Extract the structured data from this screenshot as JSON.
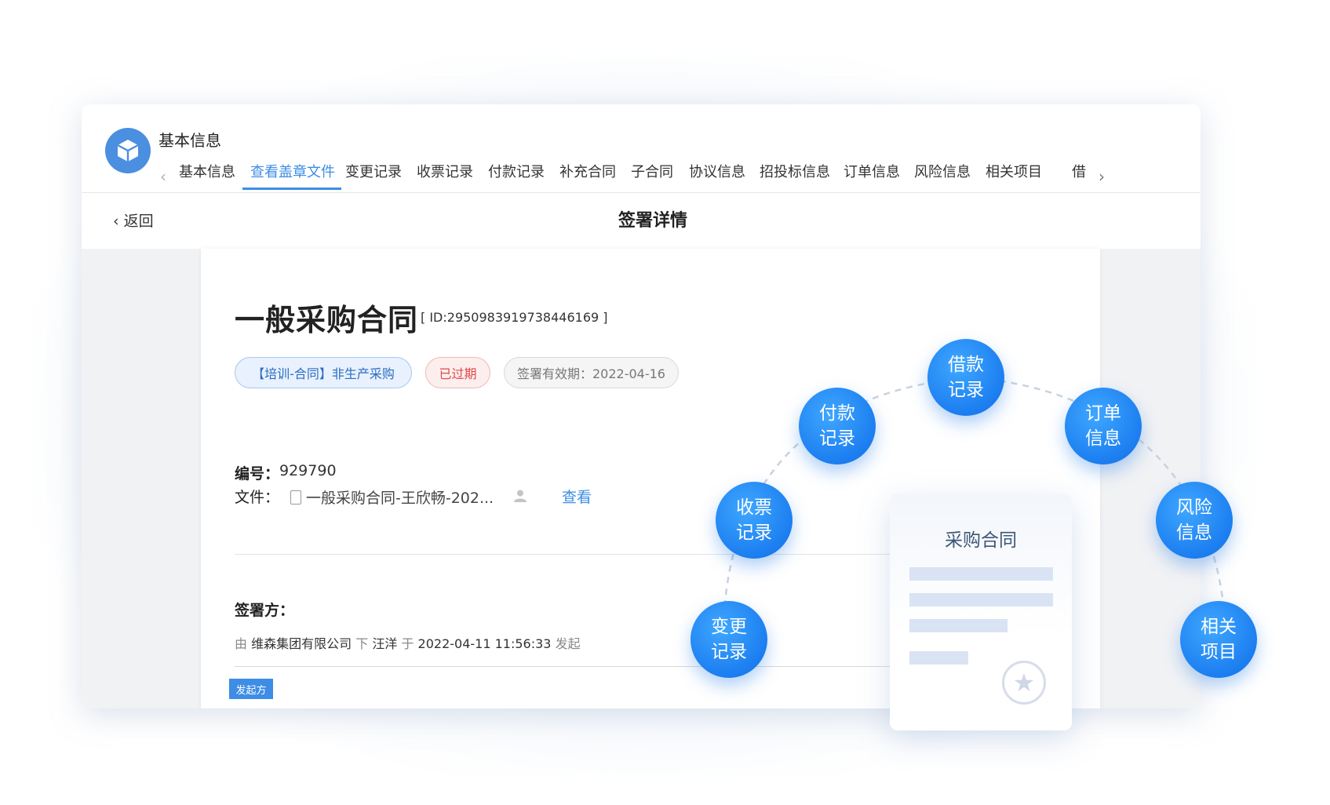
{
  "app": {
    "title": "基本信息"
  },
  "tabs": [
    "基本信息",
    "查看盖章文件",
    "变更记录",
    "收票记录",
    "付款记录",
    "补充合同",
    "子合同",
    "协议信息",
    "招投标信息",
    "订单信息",
    "风险信息",
    "相关项目",
    "借"
  ],
  "tabs_active_index": 1,
  "subheader": {
    "back_label": "返回",
    "title": "签署详情"
  },
  "contract": {
    "title": "一般采购合同",
    "id_text": "[ ID:2950983919738446169 ]",
    "tags": {
      "category": "【培训-合同】非生产采购",
      "status": "已过期",
      "validity": "签署有效期：2022-04-16"
    },
    "number_label": "编号：",
    "number_value": "929790",
    "file_label": "文件：",
    "file_name": "一般采购合同-王欣畅-202...",
    "view_label": "查看",
    "signer_label": "签署方：",
    "sign_info": {
      "by": "由",
      "company": "维森集团有限公司",
      "under": "下",
      "person": "汪洋",
      "at": "于",
      "time": "2022-04-11 11:56:33",
      "action": "发起"
    },
    "initiator_badge": "发起方"
  },
  "overlay": {
    "card_title": "采购合同",
    "nodes": [
      "变更记录",
      "收票记录",
      "付款记录",
      "借款记录",
      "订单信息",
      "风险信息",
      "相关项目"
    ]
  },
  "colors": {
    "accent": "#3d8de6",
    "node": "#1c7ef0",
    "expired": "#e04a4a"
  }
}
